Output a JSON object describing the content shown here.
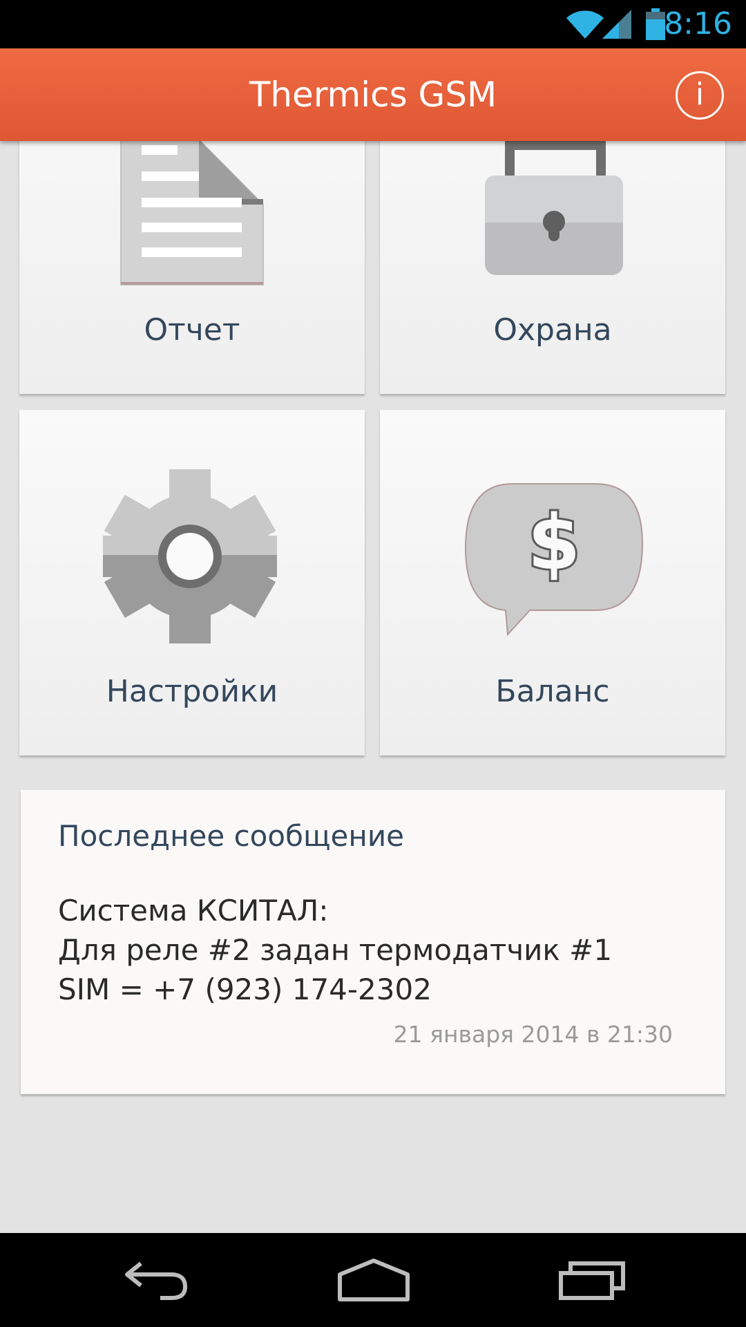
{
  "status_bar": {
    "time": "8:16",
    "icons": [
      "wifi-icon",
      "signal-icon",
      "battery-icon"
    ],
    "accent": "#2fb3e4"
  },
  "action_bar": {
    "title": "Thermics GSM",
    "info_label": "i",
    "color": "#e9613c"
  },
  "tiles": [
    {
      "label": "Отчет",
      "icon": "document-icon"
    },
    {
      "label": "Охрана",
      "icon": "padlock-icon"
    },
    {
      "label": "Настройки",
      "icon": "gear-icon"
    },
    {
      "label": "Баланс",
      "icon": "balance-bubble-icon"
    }
  ],
  "last_message": {
    "title": "Последнее сообщение",
    "lines": [
      "Система КСИТАЛ:",
      "Для реле #2 задан термодатчик #1",
      "SIM = +7 (923) 174-2302"
    ],
    "date": "21 января 2014 в 21:30"
  },
  "nav_bar": {
    "icons": [
      "back-icon",
      "home-icon",
      "recent-apps-icon"
    ]
  }
}
